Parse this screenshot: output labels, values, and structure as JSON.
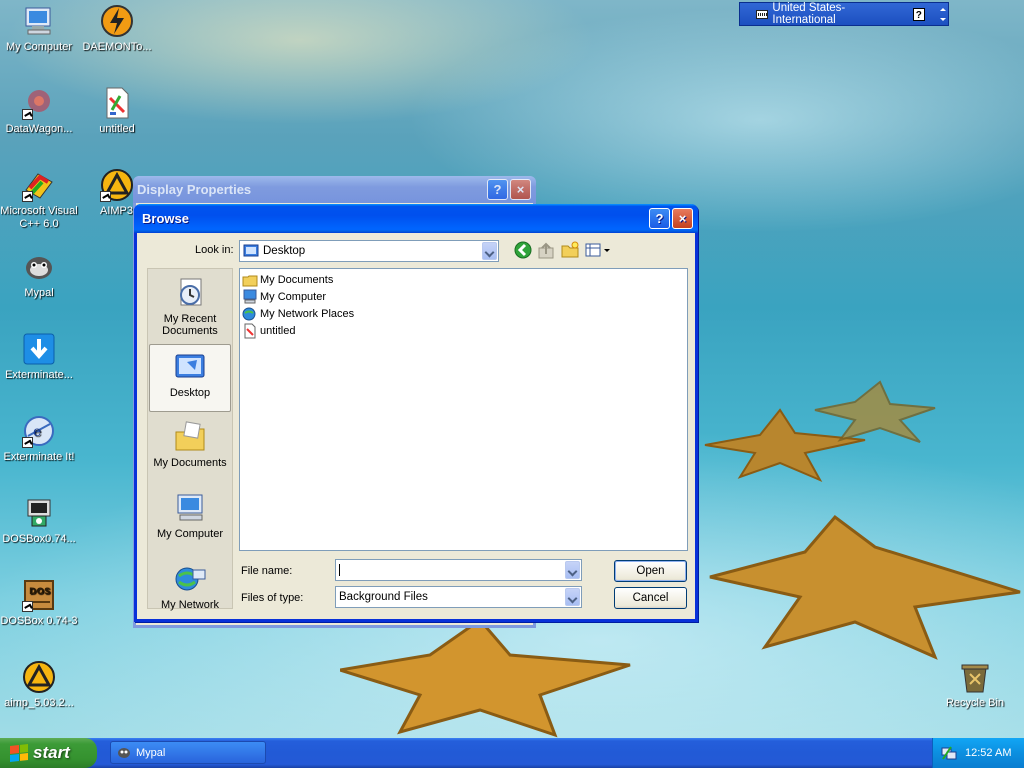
{
  "desktop": {
    "icons": [
      {
        "label": "My Computer"
      },
      {
        "label": "DAEMONTo..."
      },
      {
        "label": "DataWagon..."
      },
      {
        "label": "untitled"
      },
      {
        "label": "Microsoft Visual C++ 6.0"
      },
      {
        "label": "AIMP3"
      },
      {
        "label": "Mypal"
      },
      {
        "label": "Exterminate..."
      },
      {
        "label": "Exterminate It!"
      },
      {
        "label": "DOSBox0.74..."
      },
      {
        "label": "DOSBox 0.74-3"
      },
      {
        "label": "aimp_5.03.2..."
      },
      {
        "label": "Recycle Bin"
      }
    ]
  },
  "language_bar": {
    "label": "United States-International"
  },
  "background_window": {
    "title": "Display Properties"
  },
  "dialog": {
    "title": "Browse",
    "title_buttons": {
      "help": "?",
      "close": "×"
    },
    "look_in_label": "Look in:",
    "look_in_value": "Desktop",
    "places": [
      {
        "label": "My Recent Documents"
      },
      {
        "label": "Desktop"
      },
      {
        "label": "My Documents"
      },
      {
        "label": "My Computer"
      },
      {
        "label": "My Network"
      }
    ],
    "files": [
      {
        "name": "My Documents"
      },
      {
        "name": "My Computer"
      },
      {
        "name": "My Network Places"
      },
      {
        "name": "untitled"
      }
    ],
    "file_name_label": "File name:",
    "file_name_value": "",
    "files_of_type_label": "Files of type:",
    "files_of_type_value": "Background Files",
    "open_label": "Open",
    "cancel_label": "Cancel"
  },
  "taskbar": {
    "start_label": "start",
    "tasks": [
      {
        "label": "Mypal"
      }
    ],
    "clock": "12:52 AM"
  }
}
